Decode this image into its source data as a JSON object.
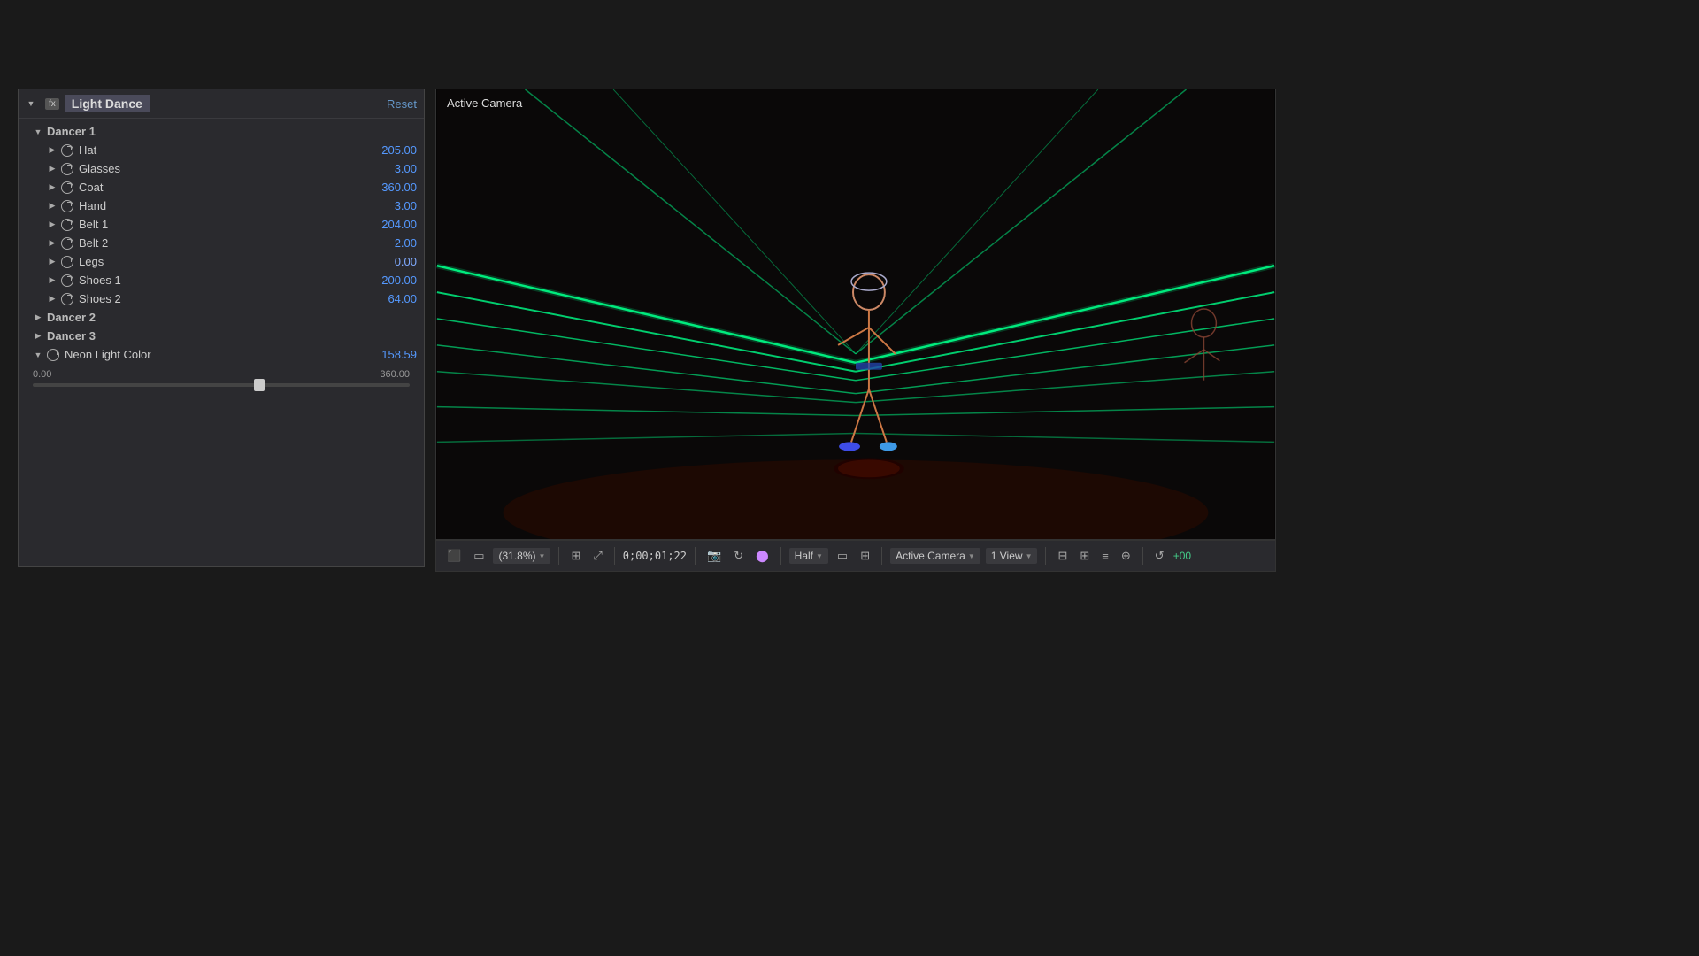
{
  "panel": {
    "fx_label": "fx",
    "title": "Light Dance",
    "reset_label": "Reset",
    "dancer1": {
      "label": "Dancer 1",
      "items": [
        {
          "name": "Hat",
          "value": "205.00"
        },
        {
          "name": "Glasses",
          "value": "3.00"
        },
        {
          "name": "Coat",
          "value": "360.00"
        },
        {
          "name": "Hand",
          "value": "3.00"
        },
        {
          "name": "Belt 1",
          "value": "204.00"
        },
        {
          "name": "Belt 2",
          "value": "2.00"
        },
        {
          "name": "Legs",
          "value": "0.00"
        },
        {
          "name": "Shoes 1",
          "value": "200.00"
        },
        {
          "name": "Shoes 2",
          "value": "64.00"
        }
      ]
    },
    "dancer2": {
      "label": "Dancer 2"
    },
    "dancer3": {
      "label": "Dancer 3"
    },
    "neon_light": {
      "label": "Neon Light Color",
      "value": "158.59",
      "min": "0.00",
      "max": "360.00"
    }
  },
  "viewport": {
    "label": "Active Camera"
  },
  "toolbar": {
    "zoom": "(31.8%)",
    "timecode": "0;00;01;22",
    "quality": "Half",
    "camera": "Active Camera",
    "views": "1 View",
    "plus_label": "+00"
  }
}
